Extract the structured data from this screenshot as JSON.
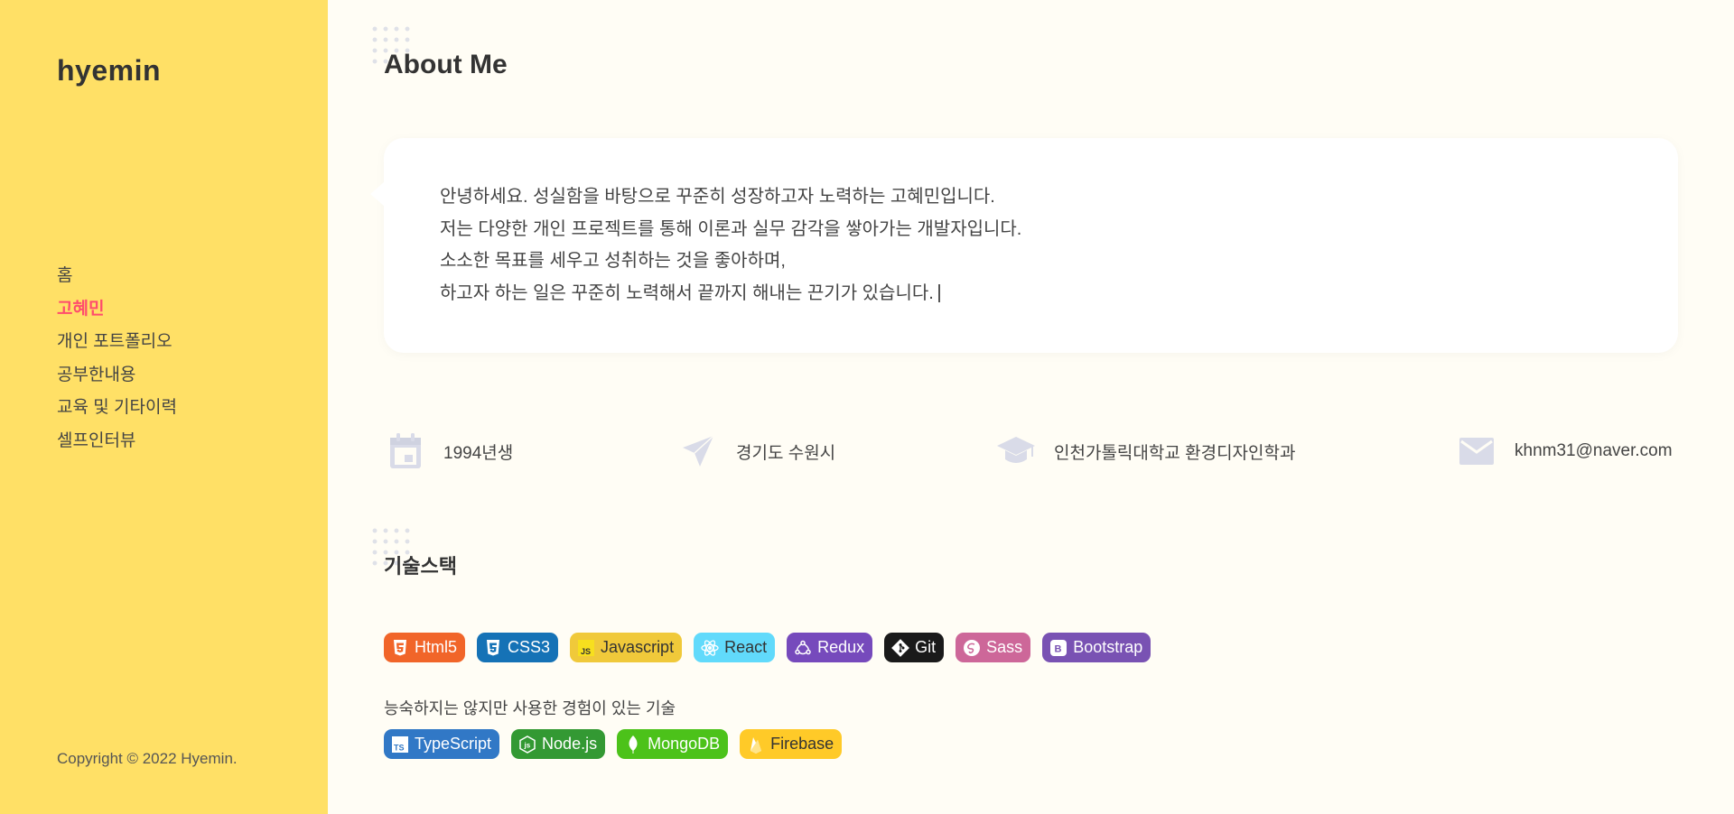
{
  "sidebar": {
    "brand": "hyemin",
    "nav": [
      {
        "label": "홈"
      },
      {
        "label": "고혜민"
      },
      {
        "label": "개인 포트폴리오"
      },
      {
        "label": "공부한내용"
      },
      {
        "label": "교육 및 기타이력"
      },
      {
        "label": "셀프인터뷰"
      }
    ],
    "active_index": 1,
    "copyright": "Copyright © 2022 Hyemin."
  },
  "main": {
    "title": "About Me",
    "intro": [
      "안녕하세요. 성실함을 바탕으로 꾸준히 성장하고자 노력하는 고혜민입니다.",
      "저는 다양한 개인 프로젝트를 통해 이론과 실무 감각을 쌓아가는 개발자입니다.",
      "소소한 목표를 세우고 성취하는 것을 좋아하며,",
      "하고자 하는 일은 꾸준히 노력해서 끝까지 해내는 끈기가 있습니다."
    ],
    "info": [
      {
        "icon": "calendar-icon",
        "text": "1994년생"
      },
      {
        "icon": "send-icon",
        "text": "경기도 수원시"
      },
      {
        "icon": "graduation-cap-icon",
        "text": "인천가톨릭대학교 환경디자인학과"
      },
      {
        "icon": "mail-icon",
        "text": "khnm31@naver.com"
      }
    ],
    "skills_title": "기술스택",
    "skills": [
      {
        "label": "Html5",
        "color": "#f16529",
        "icon": "html5-icon"
      },
      {
        "label": "CSS3",
        "color": "#1572b6",
        "icon": "css3-icon"
      },
      {
        "label": "Javascript",
        "color": "#f0db4f",
        "icon": "javascript-icon"
      },
      {
        "label": "React",
        "color": "#61dafb",
        "icon": "react-icon"
      },
      {
        "label": "Redux",
        "color": "#764abc",
        "icon": "redux-icon"
      },
      {
        "label": "Git",
        "color": "#1a1a1a",
        "icon": "git-icon"
      },
      {
        "label": "Sass",
        "color": "#cd6799",
        "icon": "sass-icon"
      },
      {
        "label": "Bootstrap",
        "color": "#7952b3",
        "icon": "bootstrap-icon"
      }
    ],
    "experienced_label": "능숙하지는 않지만 사용한 경험이 있는 기술",
    "experienced": [
      {
        "label": "TypeScript",
        "color": "#3178c6",
        "icon": "typescript-icon"
      },
      {
        "label": "Node.js",
        "color": "#339933",
        "icon": "nodejs-icon"
      },
      {
        "label": "MongoDB",
        "color": "#4db33d",
        "icon": "mongodb-icon"
      },
      {
        "label": "Firebase",
        "color": "#ffca28",
        "icon": "firebase-icon"
      }
    ]
  },
  "colors": {
    "sidebar_bg": "#ffe066",
    "main_bg": "#fffdf5",
    "active_nav": "#ff4d6d",
    "info_icon": "#d9dbe8"
  }
}
